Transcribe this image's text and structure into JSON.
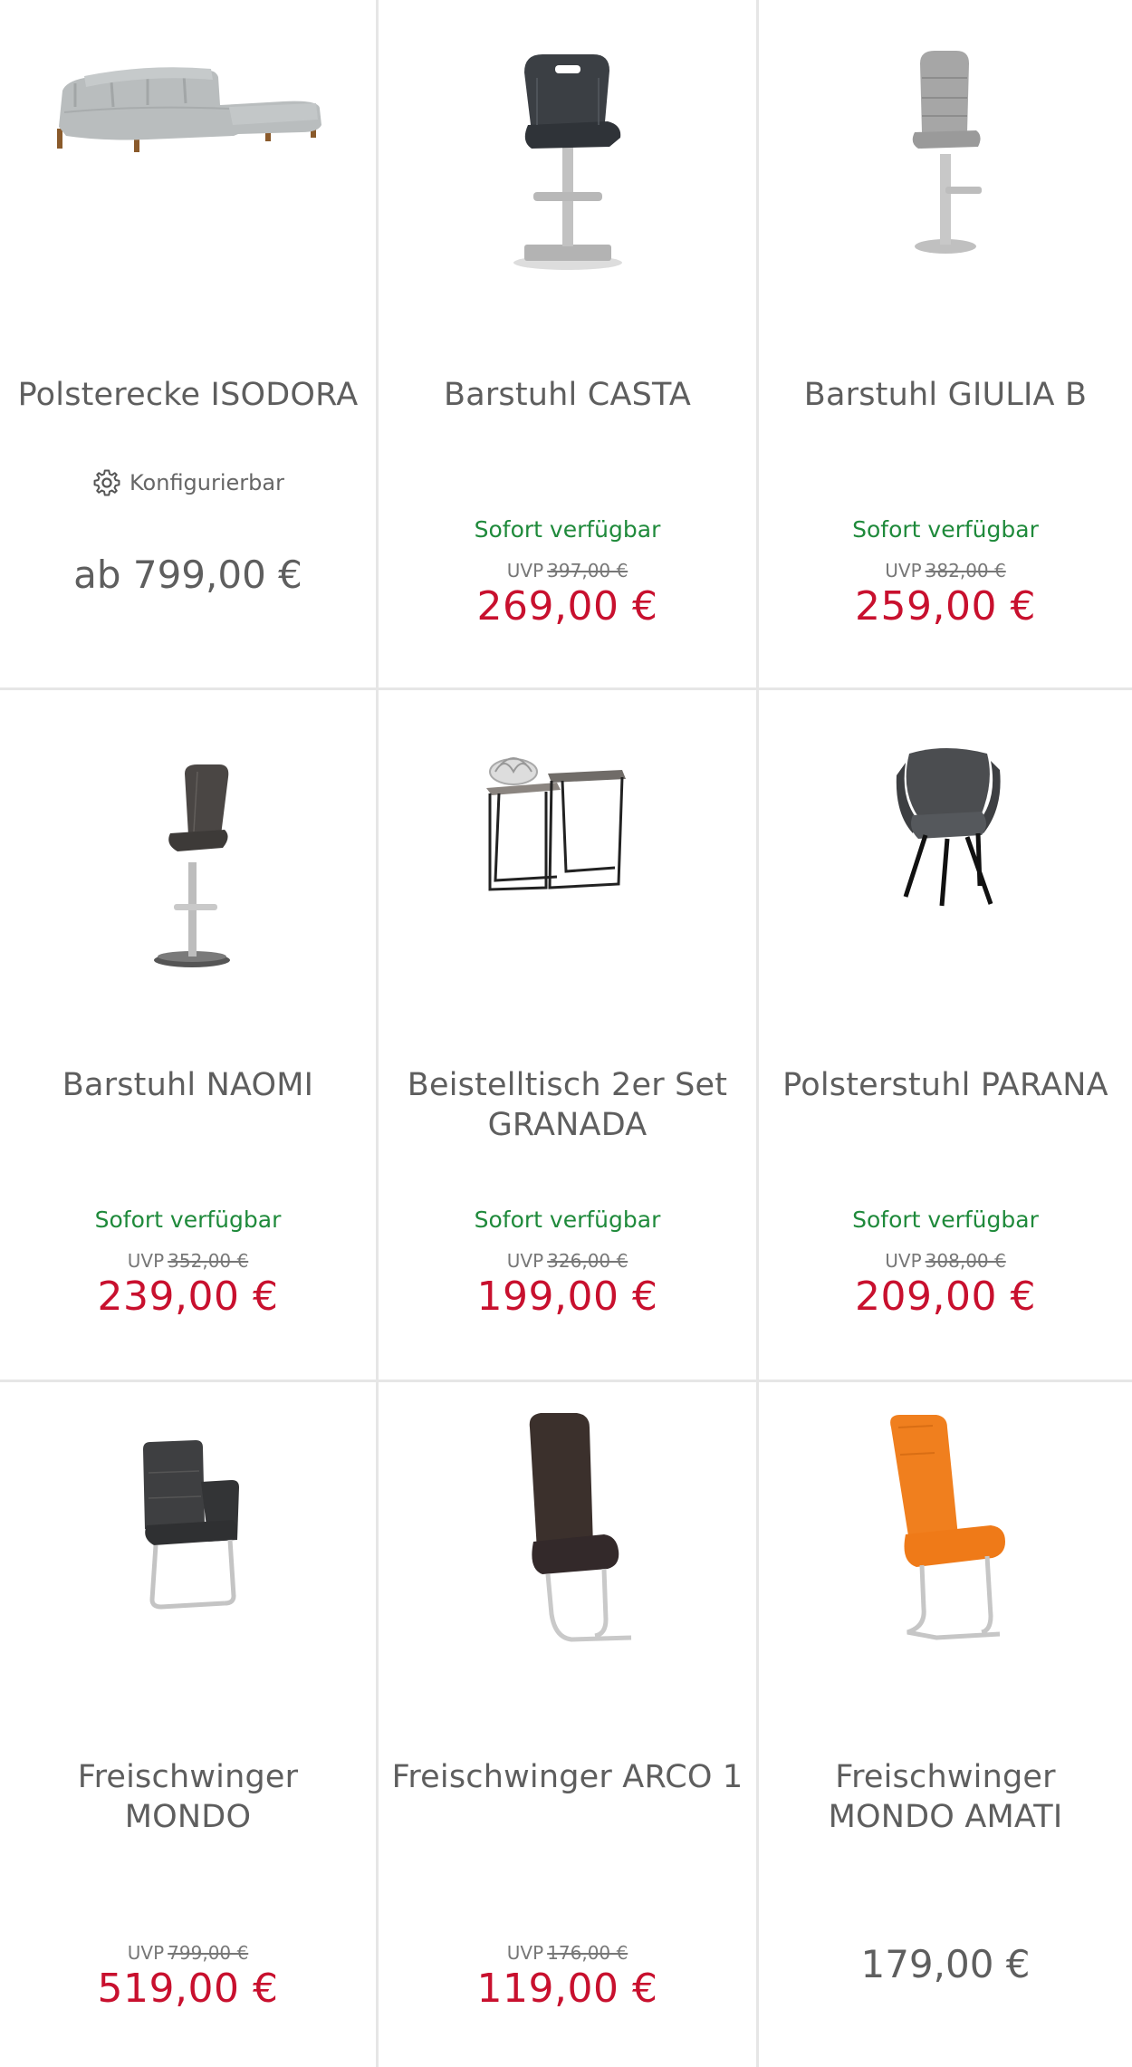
{
  "products": [
    {
      "name": "Polsterecke ISODORA",
      "image": "corner-sofa",
      "configurable_label": "Konfigurierbar",
      "availability": "",
      "uvp_label": "",
      "uvp_price": "",
      "price": "ab 799,00 €",
      "price_style": "plain"
    },
    {
      "name": "Barstuhl CASTA",
      "image": "bar-stool-dark",
      "configurable_label": "",
      "availability": "Sofort verfügbar",
      "uvp_label": "UVP",
      "uvp_price": "397,00 €",
      "price": "269,00 €",
      "price_style": "sale"
    },
    {
      "name": "Barstuhl GIULIA B",
      "image": "bar-stool-grey",
      "configurable_label": "",
      "availability": "Sofort verfügbar",
      "uvp_label": "UVP",
      "uvp_price": "382,00 €",
      "price": "259,00 €",
      "price_style": "sale"
    },
    {
      "name": "Barstuhl NAOMI",
      "image": "bar-stool-brown",
      "configurable_label": "",
      "availability": "Sofort verfügbar",
      "uvp_label": "UVP",
      "uvp_price": "352,00 €",
      "price": "239,00 €",
      "price_style": "sale"
    },
    {
      "name": "Beistelltisch 2er Set GRANADA",
      "image": "side-tables",
      "configurable_label": "",
      "availability": "Sofort verfügbar",
      "uvp_label": "UVP",
      "uvp_price": "326,00 €",
      "price": "199,00 €",
      "price_style": "sale"
    },
    {
      "name": "Polsterstuhl PARANA",
      "image": "upholstered-chair",
      "configurable_label": "",
      "availability": "Sofort verfügbar",
      "uvp_label": "UVP",
      "uvp_price": "308,00 €",
      "price": "209,00 €",
      "price_style": "sale"
    },
    {
      "name": "Freischwinger MONDO",
      "image": "cantilever-armchair",
      "configurable_label": "",
      "availability": "",
      "uvp_label": "UVP",
      "uvp_price": "799,00 €",
      "price": "519,00 €",
      "price_style": "sale"
    },
    {
      "name": "Freischwinger ARCO 1",
      "image": "cantilever-chair-brown",
      "configurable_label": "",
      "availability": "",
      "uvp_label": "UVP",
      "uvp_price": "176,00 €",
      "price": "119,00 €",
      "price_style": "sale"
    },
    {
      "name": "Freischwinger MONDO AMATI",
      "image": "cantilever-chair-orange",
      "configurable_label": "",
      "availability": "",
      "uvp_label": "",
      "uvp_price": "",
      "price": "179,00 €",
      "price_style": "plain"
    }
  ],
  "colors": {
    "sale_price": "#c8102e",
    "availability": "#1f8a3b",
    "text": "#5e5e5e",
    "divider": "#e6e6e6"
  }
}
